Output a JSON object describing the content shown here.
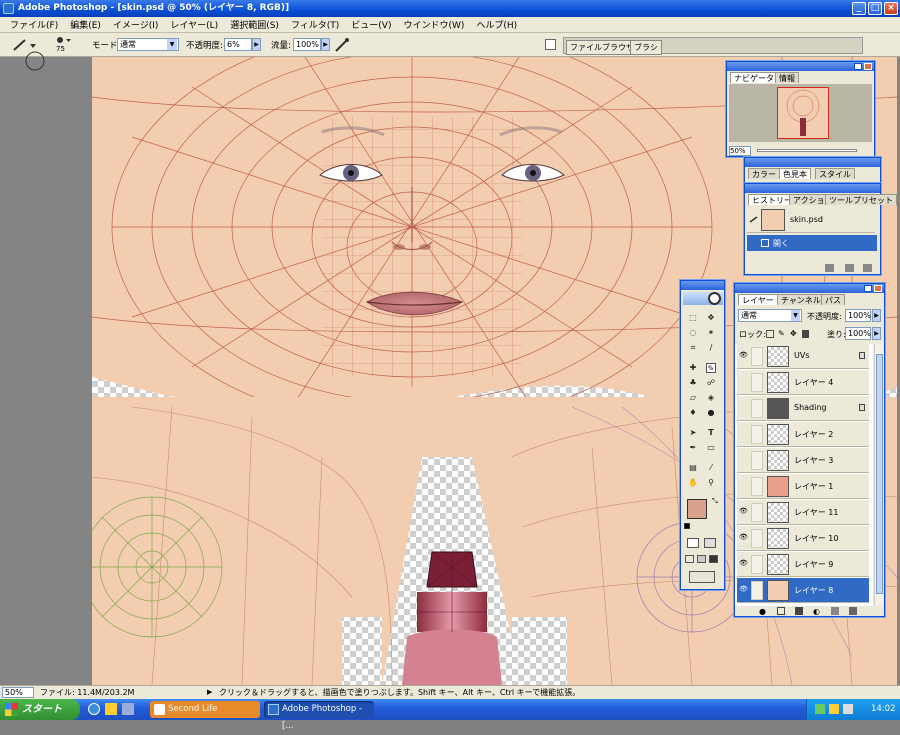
{
  "window": {
    "title": "Adobe Photoshop - [skin.psd @ 50% (レイヤー 8, RGB)]",
    "buttons": {
      "minimize": "_",
      "maximize": "□",
      "close": "×"
    }
  },
  "menu": [
    "ファイル(F)",
    "編集(E)",
    "イメージ(I)",
    "レイヤー(L)",
    "選択範囲(S)",
    "フィルタ(T)",
    "ビュー(V)",
    "ウインドウ(W)",
    "ヘルプ(H)"
  ],
  "options_bar": {
    "brush_size": "75",
    "mode_label": "モード:",
    "mode_value": "通常",
    "opacity_label": "不透明度:",
    "opacity_value": "6%",
    "flow_label": "流量:",
    "flow_value": "100%",
    "palette_tabs": [
      "ファイルブラウザ",
      "ブラシ"
    ]
  },
  "navigator": {
    "tabs": [
      "ナビゲータ",
      "情報"
    ],
    "zoom": "50%"
  },
  "swatch_panel": {
    "tabs": [
      "カラー",
      "色見本",
      "スタイル"
    ]
  },
  "history_panel": {
    "tabs": [
      "ヒストリー",
      "アクション",
      "ツールプリセット"
    ],
    "snapshot": "skin.psd",
    "states": [
      "開く"
    ]
  },
  "layers_panel": {
    "tabs": [
      "レイヤー",
      "チャンネル",
      "パス"
    ],
    "blend_mode": "通常",
    "opacity_label": "不透明度:",
    "opacity_value": "100%",
    "lock_label": "ロック:",
    "fill_label": "塗り:",
    "fill_value": "100%",
    "layers": [
      {
        "name": "UVs",
        "visible": true,
        "locked": true
      },
      {
        "name": "レイヤー 4",
        "visible": false,
        "locked": false
      },
      {
        "name": "Shading",
        "visible": false,
        "locked": true
      },
      {
        "name": "レイヤー 2",
        "visible": false,
        "locked": false
      },
      {
        "name": "レイヤー 3",
        "visible": false,
        "locked": false
      },
      {
        "name": "レイヤー 1",
        "visible": false,
        "locked": false
      },
      {
        "name": "レイヤー 11",
        "visible": true,
        "locked": false
      },
      {
        "name": "レイヤー 10",
        "visible": true,
        "locked": false
      },
      {
        "name": "レイヤー 9",
        "visible": true,
        "locked": false
      },
      {
        "name": "レイヤー 8",
        "visible": true,
        "locked": false,
        "selected": true
      }
    ]
  },
  "colors": {
    "foreground": "#d9a08a",
    "background": "#f2d6c4",
    "skin": "#f3cdb0",
    "wire": "#c0604a",
    "accent_blue": "#0a4fd6"
  },
  "status_bar": {
    "zoom": "50%",
    "file_info": "ファイル: 11.4M/203.2M",
    "hint": "クリック＆ドラッグすると、描画色で塗りつぶします。Shift キー、Alt キー、Ctrl キーで機能拡張。"
  },
  "taskbar": {
    "start": "スタート",
    "tasks": [
      "Second Life",
      "Adobe Photoshop - [..."
    ],
    "clock": "14:02"
  }
}
